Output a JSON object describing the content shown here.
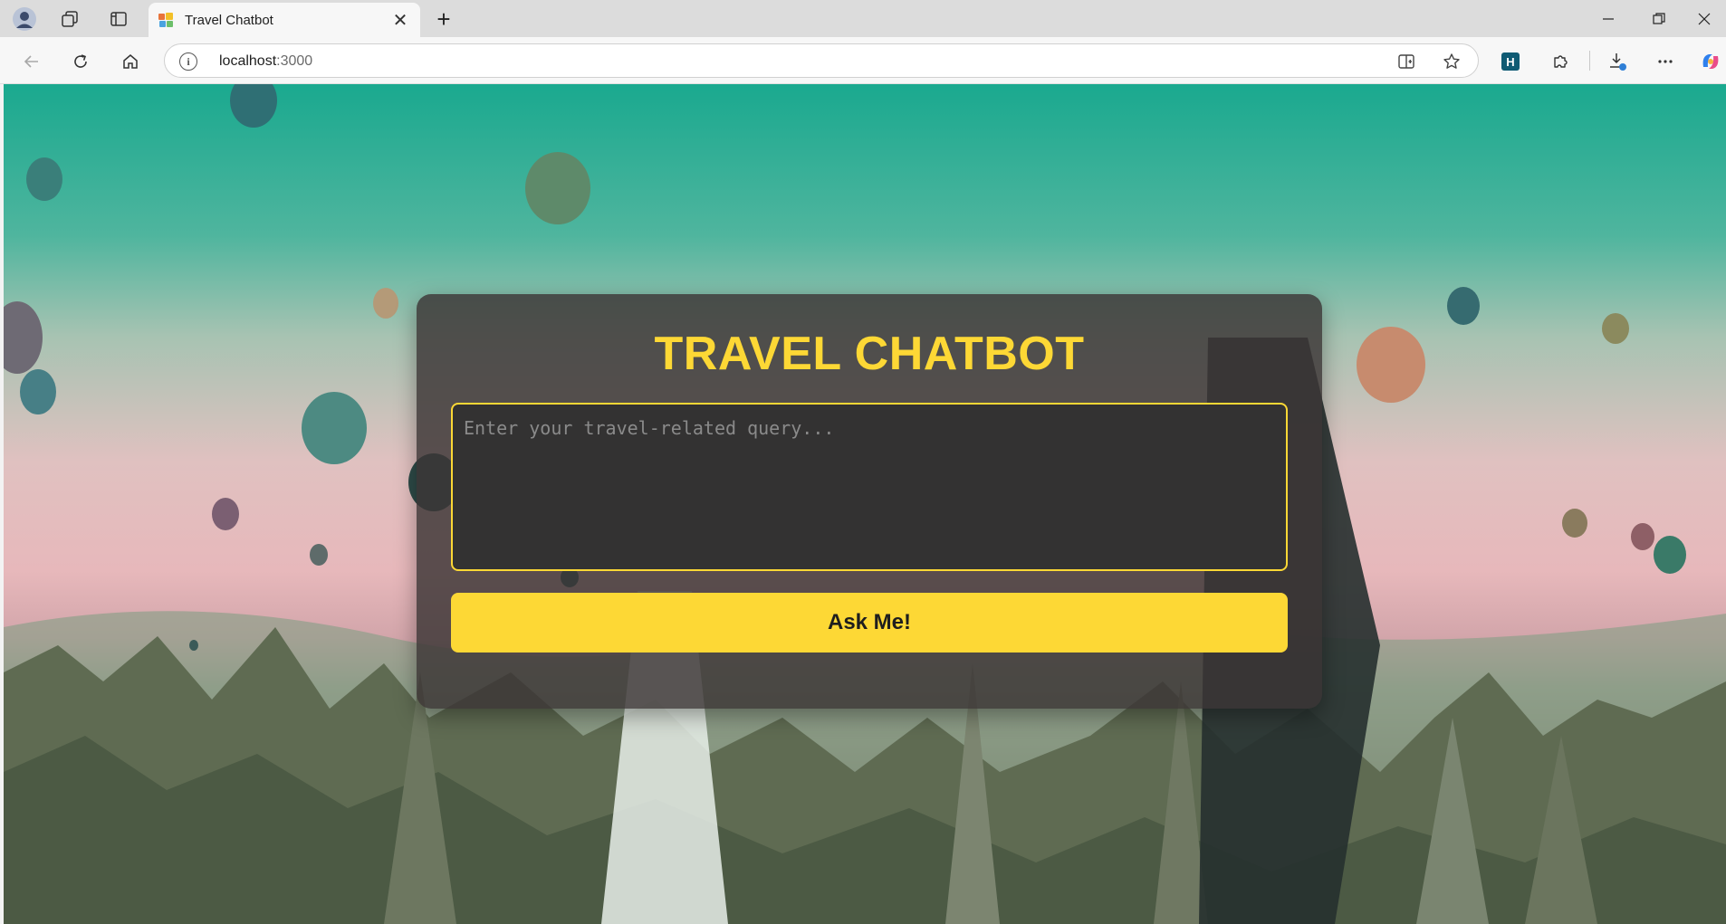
{
  "browser": {
    "tab": {
      "title": "Travel Chatbot",
      "close_glyph": "✕"
    },
    "new_tab_glyph": "+",
    "address": {
      "host": "localhost",
      "port": ":3000"
    },
    "icons": {
      "profile": "profile-avatar",
      "workspaces": "workspaces-icon",
      "tab_actions": "vertical-tabs-icon",
      "back": "back-arrow-icon",
      "refresh": "refresh-icon",
      "home": "home-icon",
      "site_info": "info-icon",
      "split_screen": "split-screen-icon",
      "favorite": "star-icon",
      "extension_h": "h-extension-icon",
      "extensions": "puzzle-icon",
      "downloads": "download-icon",
      "more": "more-icon",
      "copilot": "copilot-icon"
    }
  },
  "app": {
    "title": "TRAVEL CHATBOT",
    "query_placeholder": "Enter your travel-related query...",
    "submit_label": "Ask Me!"
  },
  "colors": {
    "accent": "#fdd835",
    "card_bg": "rgba(58,52,52,0.82)",
    "input_bg": "#333232"
  }
}
